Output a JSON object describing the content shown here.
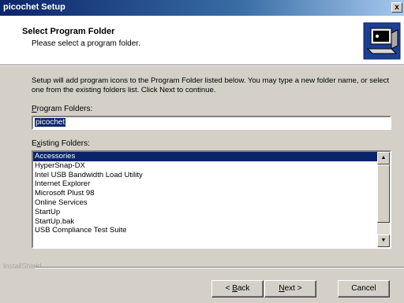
{
  "window": {
    "title": "picochet Setup",
    "close_glyph": "x"
  },
  "header": {
    "title": "Select Program Folder",
    "subtitle": "Please select a program folder.",
    "icon": "computer-setup-icon"
  },
  "body": {
    "description": "Setup will add program icons to the Program Folder listed below.  You may type a new folder name, or select one from the existing folders list.  Click Next to continue.",
    "program_folders_label": {
      "accel": "P",
      "rest": "rogram Folders:"
    },
    "program_folder_value": "picochet",
    "existing_folders_label": {
      "pre": "E",
      "accel": "x",
      "rest": "isting Folders:"
    },
    "existing_folders": [
      "Accessories",
      "HyperSnap-DX",
      "Intel USB Bandwidth Load Utility",
      "Internet Explorer",
      "Microsoft Plust 98",
      "Online Services",
      "StartUp",
      "StartUp.bak",
      "USB Compliance Test Suite"
    ],
    "selected_folder_index": 0
  },
  "footer": {
    "brand": "InstallShield",
    "back": {
      "pre": "< ",
      "accel": "B",
      "rest": "ack"
    },
    "next": {
      "pre": "",
      "accel": "N",
      "rest": "ext >"
    },
    "cancel": "Cancel"
  }
}
